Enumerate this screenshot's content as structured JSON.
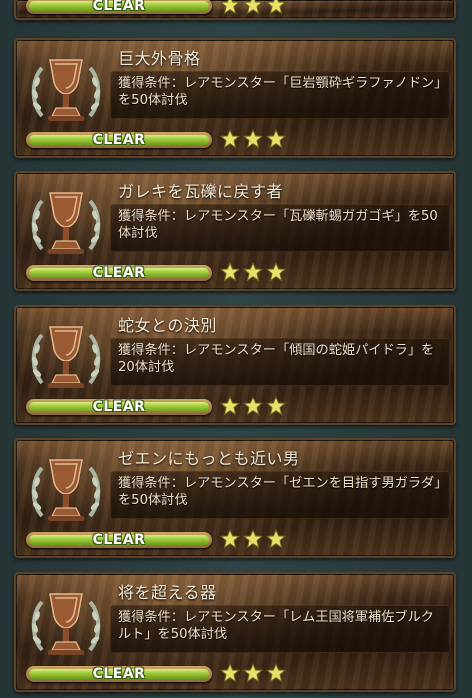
{
  "partial_card": {
    "clear_label": "CLEAR",
    "stars": 3
  },
  "achievements": [
    {
      "title": "巨大外骨格",
      "description": "獲得条件：レアモンスター「巨岩顎砕ギラファノドン」を50体討伐",
      "clear_label": "CLEAR",
      "stars": 3
    },
    {
      "title": "ガレキを瓦礫に戻す者",
      "description": "獲得条件：レアモンスター「瓦礫斬蜴ガガゴギ」を50体討伐",
      "clear_label": "CLEAR",
      "stars": 3
    },
    {
      "title": "蛇女との決別",
      "description": "獲得条件：レアモンスター「傾国の蛇姫パイドラ」を20体討伐",
      "clear_label": "CLEAR",
      "stars": 3
    },
    {
      "title": "ゼエンにもっとも近い男",
      "description": "獲得条件：レアモンスター「ゼエンを目指す男ガラダ」を50体討伐",
      "clear_label": "CLEAR",
      "stars": 3
    },
    {
      "title": "将を超える器",
      "description": "獲得条件：レアモンスター「レム王国将軍補佐ブルクルト」を50体討伐",
      "clear_label": "CLEAR",
      "stars": 3
    }
  ]
}
